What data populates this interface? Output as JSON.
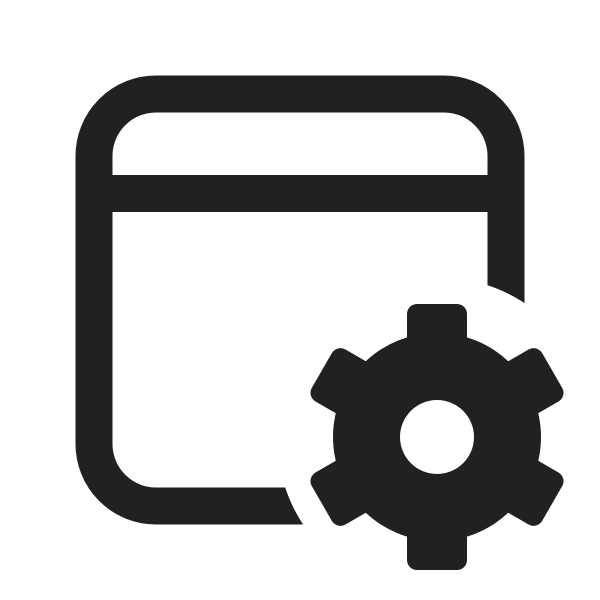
{
  "icon": {
    "name": "app-window-settings-icon",
    "color": "#212121",
    "background": "#ffffff"
  }
}
